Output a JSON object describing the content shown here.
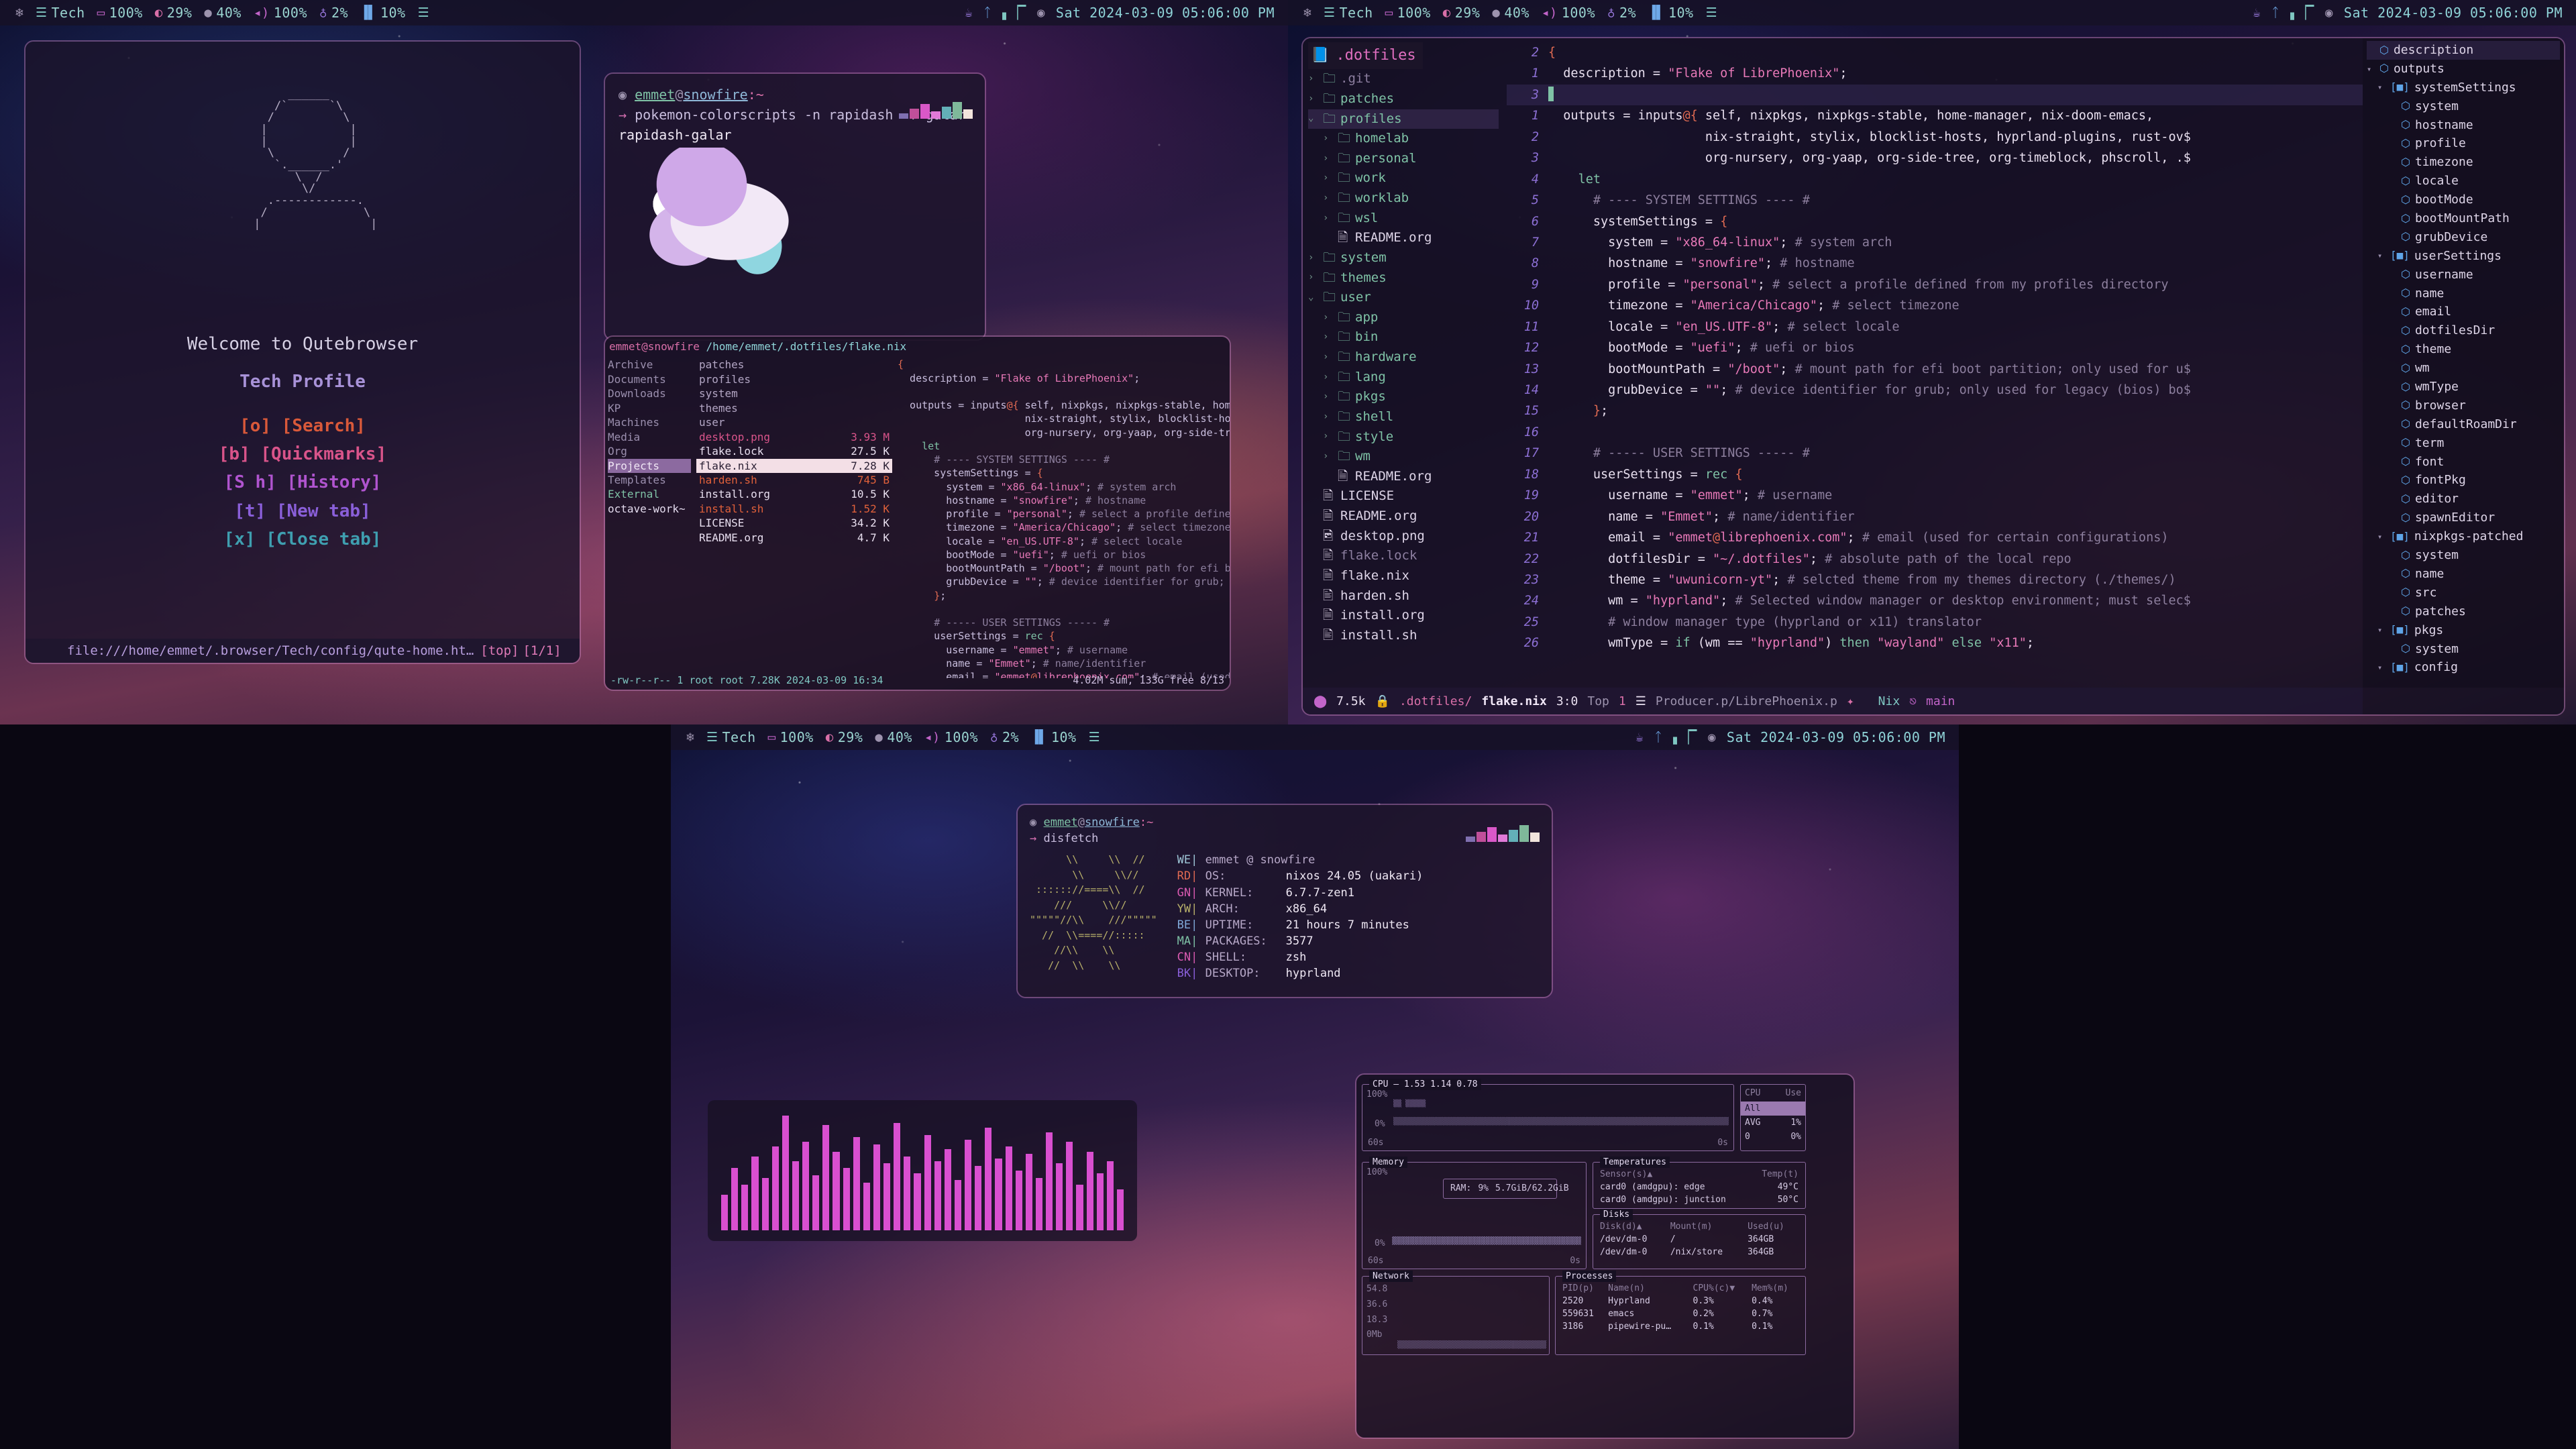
{
  "bar": {
    "left_modules": [
      {
        "icon": "nixos-snowflake-icon",
        "label": ""
      },
      {
        "icon": "workspace-icon",
        "label": "Tech"
      },
      {
        "icon": "battery-icon",
        "label": "100%"
      },
      {
        "icon": "cpu-temp-icon",
        "label": "29%"
      },
      {
        "icon": "brightness-icon",
        "label": "40%"
      },
      {
        "icon": "volume-icon",
        "label": "100%"
      },
      {
        "icon": "microphone-icon",
        "label": "2%"
      },
      {
        "icon": "memory-icon",
        "label": "10%"
      },
      {
        "icon": "menu-icon",
        "label": ""
      }
    ],
    "right_modules": [
      {
        "icon": "coffee-icon",
        "label": ""
      },
      {
        "icon": "bluetooth-icon",
        "label": ""
      },
      {
        "icon": "network-signal-icon",
        "label": ""
      },
      {
        "icon": "disc-icon",
        "label": ""
      }
    ],
    "clock": "Sat 2024-03-09 05:06:00 PM"
  },
  "qutebrowser": {
    "title": "Welcome to Qutebrowser",
    "subtitle": "Tech Profile",
    "menu": [
      {
        "key": "[o]",
        "label": "[Search]",
        "color": "#d9593a"
      },
      {
        "key": "[b]",
        "label": "[Quickmarks]",
        "color": "#d9548a"
      },
      {
        "key": "[S h]",
        "label": "[History]",
        "color": "#b054cf"
      },
      {
        "key": "[t]",
        "label": "[New tab]",
        "color": "#8a5fd9"
      },
      {
        "key": "[x]",
        "label": "[Close tab]",
        "color": "#3f9fb0"
      }
    ],
    "url": "file:///home/emmet/.browser/Tech/config/qute-home.ht…",
    "scroll": "[top]",
    "tab_indicator": "[1/1]"
  },
  "terminal_pokemon": {
    "user": "emmet",
    "at": "@",
    "host": "snowfire",
    "path": ":~",
    "prompt_arrow": "→",
    "command": "pokemon-colorscripts -n rapidash -f galar",
    "output": "rapidash-galar"
  },
  "ranger": {
    "header_user": "emmet@snowfire",
    "header_path": "/home/emmet/.dotfiles/flake.nix",
    "col1": [
      "Archive",
      "Documents",
      "Downloads",
      "KP",
      "Machines",
      "Media",
      "Org",
      "Projects",
      "Templates",
      "External",
      "octave-work~"
    ],
    "col1_selected": "Projects",
    "col2": [
      {
        "name": "patches",
        "size": "",
        "type": "dir"
      },
      {
        "name": "profiles",
        "size": "",
        "type": "dir"
      },
      {
        "name": "system",
        "size": "",
        "type": "dir"
      },
      {
        "name": "themes",
        "size": "",
        "type": "dir"
      },
      {
        "name": "user",
        "size": "",
        "type": "dir"
      },
      {
        "name": "desktop.png",
        "size": "3.93 M",
        "type": "image"
      },
      {
        "name": "flake.lock",
        "size": "27.5 K",
        "type": "file"
      },
      {
        "name": "flake.nix",
        "size": "7.28 K",
        "type": "sel"
      },
      {
        "name": "harden.sh",
        "size": "745 B",
        "type": "exec"
      },
      {
        "name": "install.org",
        "size": "10.5 K",
        "type": "file"
      },
      {
        "name": "install.sh",
        "size": "1.52 K",
        "type": "exec"
      },
      {
        "name": "LICENSE",
        "size": "34.2 K",
        "type": "file"
      },
      {
        "name": "README.org",
        "size": "4.7 K",
        "type": "file"
      }
    ],
    "footer_left": "-rw-r--r-- 1 root root 7.28K 2024-03-09 16:34",
    "footer_right": "4.02M sum, 133G free  8/13"
  },
  "emacs": {
    "tree_title": ".dotfiles",
    "tree": [
      {
        "depth": 0,
        "arrow": "›",
        "icon": "folder-icon",
        "name": ".git",
        "kind": "dim-folder"
      },
      {
        "depth": 0,
        "arrow": "›",
        "icon": "folder-icon",
        "name": "patches",
        "kind": "folder"
      },
      {
        "depth": 0,
        "arrow": "⌄",
        "icon": "folder-icon",
        "name": "profiles",
        "kind": "folder",
        "selected": true
      },
      {
        "depth": 1,
        "arrow": "›",
        "icon": "folder-icon",
        "name": "homelab",
        "kind": "folder"
      },
      {
        "depth": 1,
        "arrow": "›",
        "icon": "folder-icon",
        "name": "personal",
        "kind": "folder"
      },
      {
        "depth": 1,
        "arrow": "›",
        "icon": "folder-icon",
        "name": "work",
        "kind": "folder"
      },
      {
        "depth": 1,
        "arrow": "›",
        "icon": "folder-icon",
        "name": "worklab",
        "kind": "folder"
      },
      {
        "depth": 1,
        "arrow": "›",
        "icon": "folder-icon",
        "name": "wsl",
        "kind": "folder"
      },
      {
        "depth": 1,
        "arrow": "",
        "icon": "document-icon",
        "name": "README.org",
        "kind": "file"
      },
      {
        "depth": 0,
        "arrow": "›",
        "icon": "folder-icon",
        "name": "system",
        "kind": "folder"
      },
      {
        "depth": 0,
        "arrow": "›",
        "icon": "folder-icon",
        "name": "themes",
        "kind": "folder"
      },
      {
        "depth": 0,
        "arrow": "⌄",
        "icon": "folder-icon",
        "name": "user",
        "kind": "folder"
      },
      {
        "depth": 1,
        "arrow": "›",
        "icon": "folder-icon",
        "name": "app",
        "kind": "folder"
      },
      {
        "depth": 1,
        "arrow": "›",
        "icon": "folder-icon",
        "name": "bin",
        "kind": "folder"
      },
      {
        "depth": 1,
        "arrow": "›",
        "icon": "folder-icon",
        "name": "hardware",
        "kind": "folder"
      },
      {
        "depth": 1,
        "arrow": "›",
        "icon": "folder-icon",
        "name": "lang",
        "kind": "folder"
      },
      {
        "depth": 1,
        "arrow": "›",
        "icon": "folder-icon",
        "name": "pkgs",
        "kind": "folder"
      },
      {
        "depth": 1,
        "arrow": "›",
        "icon": "folder-icon",
        "name": "shell",
        "kind": "folder"
      },
      {
        "depth": 1,
        "arrow": "›",
        "icon": "folder-icon",
        "name": "style",
        "kind": "folder"
      },
      {
        "depth": 1,
        "arrow": "›",
        "icon": "folder-icon",
        "name": "wm",
        "kind": "folder"
      },
      {
        "depth": 1,
        "arrow": "",
        "icon": "document-icon",
        "name": "README.org",
        "kind": "file"
      },
      {
        "depth": 0,
        "arrow": "",
        "icon": "document-icon",
        "name": "LICENSE",
        "kind": "file"
      },
      {
        "depth": 0,
        "arrow": "",
        "icon": "document-icon",
        "name": "README.org",
        "kind": "file"
      },
      {
        "depth": 0,
        "arrow": "",
        "icon": "image-icon",
        "name": "desktop.png",
        "kind": "file"
      },
      {
        "depth": 0,
        "arrow": "",
        "icon": "binary-icon",
        "name": "flake.lock",
        "kind": "dim-file"
      },
      {
        "depth": 0,
        "arrow": "",
        "icon": "document-icon",
        "name": "flake.nix",
        "kind": "file"
      },
      {
        "depth": 0,
        "arrow": "",
        "icon": "binary-icon",
        "name": "harden.sh",
        "kind": "file"
      },
      {
        "depth": 0,
        "arrow": "",
        "icon": "document-icon",
        "name": "install.org",
        "kind": "file"
      },
      {
        "depth": 0,
        "arrow": "",
        "icon": "binary-icon",
        "name": "install.sh",
        "kind": "file"
      }
    ],
    "code_lines": [
      {
        "num": "2",
        "text": "{",
        "cur": false
      },
      {
        "num": "1",
        "text": "  description = \"Flake of LibrePhoenix\";",
        "cur": false
      },
      {
        "num": "3",
        "text": "",
        "cur": true
      },
      {
        "num": "1",
        "text": "  outputs = inputs@{ self, nixpkgs, nixpkgs-stable, home-manager, nix-doom-emacs,",
        "cur": false
      },
      {
        "num": "2",
        "text": "                     nix-straight, stylix, blocklist-hosts, hyprland-plugins, rust-ov$",
        "cur": false
      },
      {
        "num": "3",
        "text": "                     org-nursery, org-yaap, org-side-tree, org-timeblock, phscroll, .$",
        "cur": false
      },
      {
        "num": "4",
        "text": "    let",
        "cur": false
      },
      {
        "num": "5",
        "text": "      # ---- SYSTEM SETTINGS ---- #",
        "cur": false
      },
      {
        "num": "6",
        "text": "      systemSettings = {",
        "cur": false
      },
      {
        "num": "7",
        "text": "        system = \"x86_64-linux\"; # system arch",
        "cur": false
      },
      {
        "num": "8",
        "text": "        hostname = \"snowfire\"; # hostname",
        "cur": false
      },
      {
        "num": "9",
        "text": "        profile = \"personal\"; # select a profile defined from my profiles directory",
        "cur": false
      },
      {
        "num": "10",
        "text": "        timezone = \"America/Chicago\"; # select timezone",
        "cur": false
      },
      {
        "num": "11",
        "text": "        locale = \"en_US.UTF-8\"; # select locale",
        "cur": false
      },
      {
        "num": "12",
        "text": "        bootMode = \"uefi\"; # uefi or bios",
        "cur": false
      },
      {
        "num": "13",
        "text": "        bootMountPath = \"/boot\"; # mount path for efi boot partition; only used for u$",
        "cur": false
      },
      {
        "num": "14",
        "text": "        grubDevice = \"\"; # device identifier for grub; only used for legacy (bios) bo$",
        "cur": false
      },
      {
        "num": "15",
        "text": "      };",
        "cur": false
      },
      {
        "num": "16",
        "text": "",
        "cur": false
      },
      {
        "num": "17",
        "text": "      # ----- USER SETTINGS ----- #",
        "cur": false
      },
      {
        "num": "18",
        "text": "      userSettings = rec {",
        "cur": false
      },
      {
        "num": "19",
        "text": "        username = \"emmet\"; # username",
        "cur": false
      },
      {
        "num": "20",
        "text": "        name = \"Emmet\"; # name/identifier",
        "cur": false
      },
      {
        "num": "21",
        "text": "        email = \"emmet@librephoenix.com\"; # email (used for certain configurations)",
        "cur": false
      },
      {
        "num": "22",
        "text": "        dotfilesDir = \"~/.dotfiles\"; # absolute path of the local repo",
        "cur": false
      },
      {
        "num": "23",
        "text": "        theme = \"uwunicorn-yt\"; # selcted theme from my themes directory (./themes/)",
        "cur": false
      },
      {
        "num": "24",
        "text": "        wm = \"hyprland\"; # Selected window manager or desktop environment; must selec$",
        "cur": false
      },
      {
        "num": "25",
        "text": "        # window manager type (hyprland or x11) translator",
        "cur": false
      },
      {
        "num": "26",
        "text": "        wmType = if (wm == \"hyprland\") then \"wayland\" else \"x11\";",
        "cur": false
      }
    ],
    "modeline": {
      "encoding_icon": "circle-icon",
      "size": "7.5k",
      "lock_icon": "lock-icon",
      "path_dir": ".dotfiles/",
      "path_file": "flake.nix",
      "position": "3:0",
      "scroll": "Top",
      "extra": "1",
      "project_icon": "layers-icon",
      "project": "Producer.p/LibrePhoenix.p",
      "rocket_icon": "rocket-icon",
      "mode": "Nix",
      "branch_icon": "git-branch-icon",
      "branch": "main"
    },
    "imenu": [
      {
        "depth": 0,
        "arrow": "",
        "icon": "cube-icon",
        "name": "description",
        "selected": true
      },
      {
        "depth": 0,
        "arrow": "▾",
        "icon": "cube-icon",
        "name": "outputs"
      },
      {
        "depth": 1,
        "arrow": "▾",
        "icon": "bracket-icon",
        "name": "systemSettings"
      },
      {
        "depth": 2,
        "arrow": "",
        "icon": "cube-icon",
        "name": "system"
      },
      {
        "depth": 2,
        "arrow": "",
        "icon": "cube-icon",
        "name": "hostname"
      },
      {
        "depth": 2,
        "arrow": "",
        "icon": "cube-icon",
        "name": "profile"
      },
      {
        "depth": 2,
        "arrow": "",
        "icon": "cube-icon",
        "name": "timezone"
      },
      {
        "depth": 2,
        "arrow": "",
        "icon": "cube-icon",
        "name": "locale"
      },
      {
        "depth": 2,
        "arrow": "",
        "icon": "cube-icon",
        "name": "bootMode"
      },
      {
        "depth": 2,
        "arrow": "",
        "icon": "cube-icon",
        "name": "bootMountPath"
      },
      {
        "depth": 2,
        "arrow": "",
        "icon": "cube-icon",
        "name": "grubDevice"
      },
      {
        "depth": 1,
        "arrow": "▾",
        "icon": "bracket-icon",
        "name": "userSettings"
      },
      {
        "depth": 2,
        "arrow": "",
        "icon": "cube-icon",
        "name": "username"
      },
      {
        "depth": 2,
        "arrow": "",
        "icon": "cube-icon",
        "name": "name"
      },
      {
        "depth": 2,
        "arrow": "",
        "icon": "cube-icon",
        "name": "email"
      },
      {
        "depth": 2,
        "arrow": "",
        "icon": "cube-icon",
        "name": "dotfilesDir"
      },
      {
        "depth": 2,
        "arrow": "",
        "icon": "cube-icon",
        "name": "theme"
      },
      {
        "depth": 2,
        "arrow": "",
        "icon": "cube-icon",
        "name": "wm"
      },
      {
        "depth": 2,
        "arrow": "",
        "icon": "cube-icon",
        "name": "wmType"
      },
      {
        "depth": 2,
        "arrow": "",
        "icon": "cube-icon",
        "name": "browser"
      },
      {
        "depth": 2,
        "arrow": "",
        "icon": "cube-icon",
        "name": "defaultRoamDir"
      },
      {
        "depth": 2,
        "arrow": "",
        "icon": "cube-icon",
        "name": "term"
      },
      {
        "depth": 2,
        "arrow": "",
        "icon": "cube-icon",
        "name": "font"
      },
      {
        "depth": 2,
        "arrow": "",
        "icon": "cube-icon",
        "name": "fontPkg"
      },
      {
        "depth": 2,
        "arrow": "",
        "icon": "cube-icon",
        "name": "editor"
      },
      {
        "depth": 2,
        "arrow": "",
        "icon": "cube-icon",
        "name": "spawnEditor"
      },
      {
        "depth": 1,
        "arrow": "▾",
        "icon": "bracket-icon",
        "name": "nixpkgs-patched"
      },
      {
        "depth": 2,
        "arrow": "",
        "icon": "cube-icon",
        "name": "system"
      },
      {
        "depth": 2,
        "arrow": "",
        "icon": "cube-icon",
        "name": "name"
      },
      {
        "depth": 2,
        "arrow": "",
        "icon": "cube-icon",
        "name": "src"
      },
      {
        "depth": 2,
        "arrow": "",
        "icon": "cube-icon",
        "name": "patches"
      },
      {
        "depth": 1,
        "arrow": "▾",
        "icon": "bracket-icon",
        "name": "pkgs"
      },
      {
        "depth": 2,
        "arrow": "",
        "icon": "cube-icon",
        "name": "system"
      },
      {
        "depth": 1,
        "arrow": "▾",
        "icon": "bracket-icon",
        "name": "config"
      }
    ]
  },
  "disfetch": {
    "user": "emmet",
    "at": "@",
    "host": "snowfire",
    "path": ":~",
    "prompt_arrow": "→",
    "command": "disfetch",
    "title": "emmet @ snowfire",
    "color_codes": [
      "WE",
      "RD",
      "GN",
      "YW",
      "BE",
      "MA",
      "CN",
      "BK"
    ],
    "rows": [
      {
        "key": "OS:",
        "value": "nixos 24.05 (uakari)"
      },
      {
        "key": "KERNEL:",
        "value": "6.7.7-zen1"
      },
      {
        "key": "ARCH:",
        "value": "x86_64"
      },
      {
        "key": "UPTIME:",
        "value": "21 hours 7 minutes"
      },
      {
        "key": "PACKAGES:",
        "value": "3577"
      },
      {
        "key": "SHELL:",
        "value": "zsh"
      },
      {
        "key": "DESKTOP:",
        "value": "hyprland"
      }
    ],
    "art": "      \\\\     \\\\  //\n       \\\\     \\\\//\n :::::://====\\\\  //\n    ///     \\\\//\n\"\"\"\"\"//\\\\    ///\"\"\"\"\"\n  //  \\\\====//:::::\n    //\\\\    \\\\\n   //  \\\\    \\\\"
  },
  "cava": {
    "bars": [
      30,
      52,
      38,
      62,
      44,
      70,
      96,
      58,
      74,
      46,
      88,
      66,
      52,
      78,
      40,
      72,
      56,
      90,
      62,
      48,
      80,
      58,
      68,
      42,
      76,
      54,
      86,
      60,
      70,
      50,
      64,
      44,
      82,
      56,
      74,
      38,
      66,
      48,
      58,
      34
    ]
  },
  "btop": {
    "cpu": {
      "title": "CPU",
      "load": "1.53 1.14 0.78",
      "y_top": "100%",
      "y_bot": "0%",
      "x_left": "60s",
      "x_right": "0s",
      "panel_h1": "CPU",
      "panel_h2": "Use",
      "rows": [
        {
          "name": "All",
          "value": "",
          "sel": true
        },
        {
          "name": "AVG",
          "value": "1%"
        },
        {
          "name": "0",
          "value": "0%"
        }
      ]
    },
    "memory": {
      "title": "Memory",
      "y_top": "100%",
      "y_bot": "0%",
      "x_left": "60s",
      "x_right": "0s",
      "ram_label": "RAM:",
      "ram_pct": "9%",
      "ram_value": "5.7GiB/62.2GiB"
    },
    "temperatures": {
      "title": "Temperatures",
      "col1": "Sensor(s)▲",
      "col2": "Temp(t)",
      "rows": [
        {
          "sensor": "card0 (amdgpu): edge",
          "temp": "49°C"
        },
        {
          "sensor": "card0 (amdgpu): junction",
          "temp": "50°C"
        }
      ]
    },
    "disks": {
      "title": "Disks",
      "cols": [
        "Disk(d)▲",
        "Mount(m)",
        "Used(u)"
      ],
      "rows": [
        [
          "/dev/dm-0",
          "/",
          "364GB"
        ],
        [
          "/dev/dm-0",
          "/nix/store",
          "364GB"
        ]
      ]
    },
    "network": {
      "title": "Network",
      "ticks": [
        "54.8",
        "36.6",
        "18.3",
        "0Mb"
      ]
    },
    "processes": {
      "title": "Processes",
      "cols": [
        "PID(p)",
        "Name(n)",
        "CPU%(c)▼",
        "Mem%(m)"
      ],
      "rows": [
        [
          "2520",
          "Hyprland",
          "0.3%",
          "0.4%"
        ],
        [
          "559631",
          "emacs",
          "0.2%",
          "0.7%"
        ],
        [
          "3186",
          "pipewire-pu…",
          "0.1%",
          "0.1%"
        ]
      ]
    }
  },
  "colors": {
    "accent_pink": "#e06fc0",
    "accent_purple": "#9b7ae0",
    "accent_teal": "#7fc2a6",
    "bar_bg": "#161126"
  }
}
